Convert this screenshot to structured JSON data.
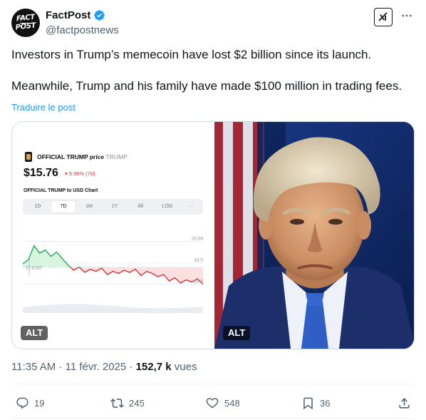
{
  "author": {
    "name": "FactPost",
    "handle": "@factpostnews",
    "avatar_text_line1": "FACT",
    "avatar_text_line2": "POST"
  },
  "tweet": {
    "paragraph1": "Investors in Trump’s memecoin have lost $2 billion since its launch.",
    "paragraph2": "Meanwhile, Trump and his family have made $100 million in trading fees.",
    "translate_label": "Traduire le post"
  },
  "media": {
    "left_image": {
      "coin_title": "OFFICIAL TRUMP price",
      "coin_ticker": "TRUMP",
      "price": "$15.76",
      "change": "▾ 9.98% (7d)",
      "chart_label": "OFFICIAL TRUMP to USD Chart",
      "tabs": [
        "1D",
        "7D",
        "1M",
        "1Y",
        "All",
        "LOG",
        "···"
      ],
      "active_tab": "7D",
      "alt_label": "ALT"
    },
    "right_image": {
      "alt_label": "ALT"
    }
  },
  "chart_data": {
    "type": "line",
    "title": "OFFICIAL TRUMP to USD Chart",
    "y_tick_labels": [
      "20.00",
      "18.0",
      "16.0"
    ],
    "reference_label": "17.5787",
    "reference_value": 17.5787,
    "ylim": [
      14.5,
      21.5
    ],
    "series": [
      {
        "values": [
          17.9,
          18.3,
          19.6,
          18.9,
          19.2,
          18.6,
          19.0,
          18.4,
          17.8,
          17.3,
          17.6,
          17.1,
          17.4,
          17.2,
          17.5,
          16.9,
          17.2,
          17.0,
          17.3,
          17.1,
          17.4,
          16.8,
          17.2,
          17.0,
          16.7,
          16.9,
          16.3,
          16.6,
          16.1,
          16.4,
          16.2,
          16.5,
          16.0
        ],
        "color_above": "#16a34a",
        "color_below": "#dc2626"
      }
    ]
  },
  "footer": {
    "time": "11:35 AM",
    "date": "11 févr. 2025",
    "views_count": "152,7 k",
    "views_label": "vues"
  },
  "actions": {
    "replies": "19",
    "reposts": "245",
    "likes": "548",
    "bookmarks": "36"
  },
  "colors": {
    "accent": "#1d9bf0",
    "text_secondary": "#536471",
    "border": "#cfd9de"
  },
  "icons": [
    "verified-badge-icon",
    "grok-icon",
    "more-icon",
    "reply-icon",
    "repost-icon",
    "like-icon",
    "bookmark-icon",
    "share-icon"
  ]
}
